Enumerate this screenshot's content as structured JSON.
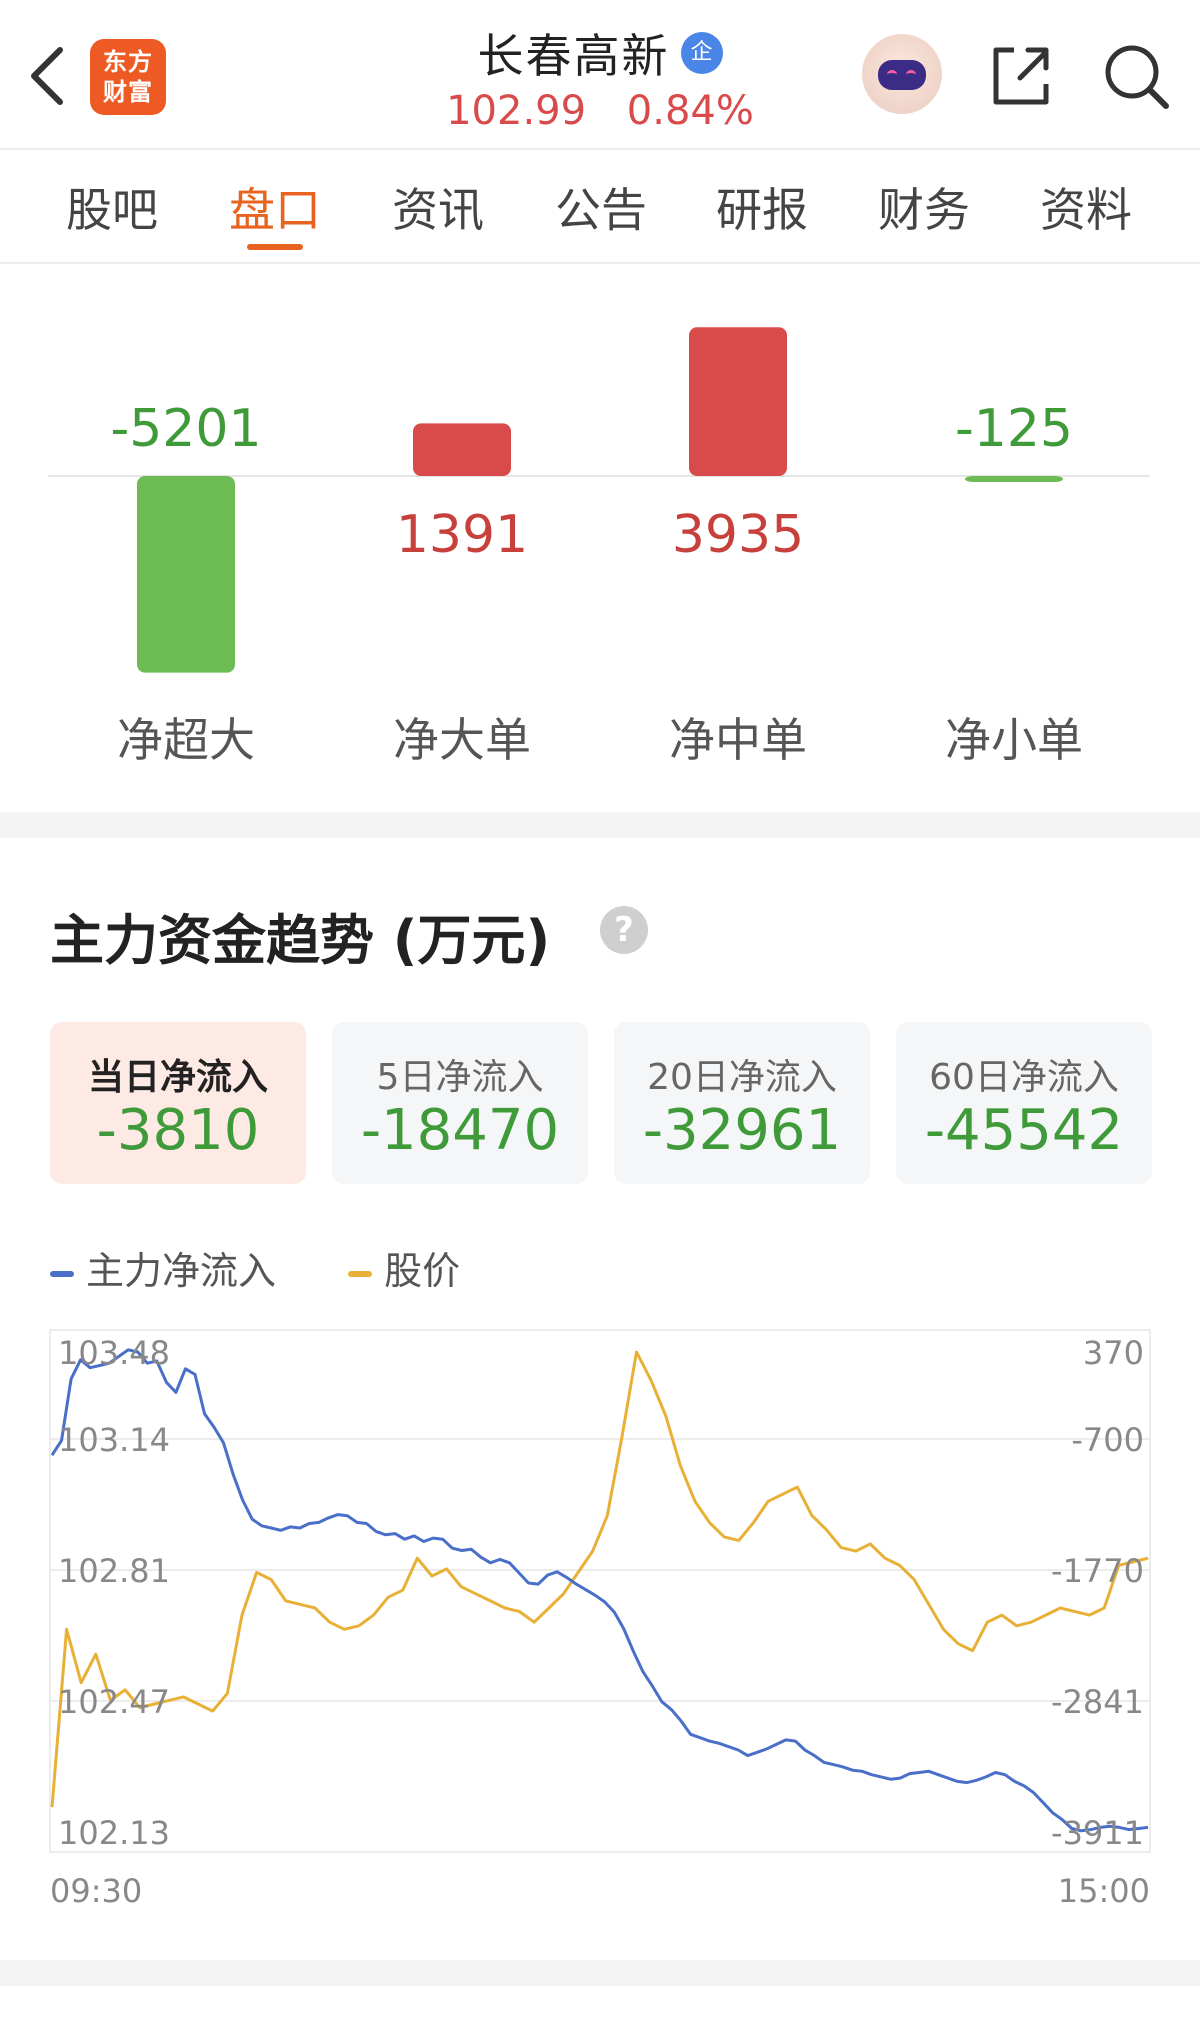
{
  "header": {
    "logo_line1": "东方",
    "logo_line2": "财富",
    "stock_name": "长春高新",
    "badge": "企",
    "price": "102.99",
    "change_pct": "0.84%"
  },
  "tabs": [
    {
      "label": "股吧"
    },
    {
      "label": "盘口",
      "active": true
    },
    {
      "label": "资讯"
    },
    {
      "label": "公告"
    },
    {
      "label": "研报"
    },
    {
      "label": "财务"
    },
    {
      "label": "资料"
    }
  ],
  "flow": {
    "items": [
      {
        "label": "净超大",
        "value": -5201
      },
      {
        "label": "净大单",
        "value": 1391
      },
      {
        "label": "净中单",
        "value": 3935
      },
      {
        "label": "净小单",
        "value": -125
      }
    ],
    "colors": {
      "positive": "#d94b4b",
      "negative": "#6dbb53",
      "positive_text": "#c8403c",
      "negative_text": "#3f9a3a"
    }
  },
  "trend": {
    "title": "主力资金趋势 (万元)",
    "help": "?",
    "periods": [
      {
        "label": "当日净流入",
        "value": "-3810",
        "active": true
      },
      {
        "label": "5日净流入",
        "value": "-18470"
      },
      {
        "label": "20日净流入",
        "value": "-32961"
      },
      {
        "label": "60日净流入",
        "value": "-45542"
      }
    ]
  },
  "chart_data": {
    "type": "line",
    "x_start_label": "09:30",
    "x_end_label": "15:00",
    "left_axis": {
      "ticks": [
        "103.48",
        "103.14",
        "102.81",
        "102.47",
        "102.13"
      ],
      "ylim": [
        102.13,
        103.48
      ]
    },
    "right_axis": {
      "ticks": [
        "370",
        "-700",
        "-1770",
        "-2841",
        "-3911"
      ],
      "ylim": [
        -3911,
        370
      ]
    },
    "grid": true,
    "legend_position": "top-left",
    "series": [
      {
        "name": "主力净流入",
        "color": "#4a6fc9",
        "axis": "right",
        "values": [
          -550,
          -420,
          130,
          300,
          230,
          250,
          270,
          330,
          390,
          370,
          270,
          290,
          100,
          10,
          220,
          170,
          -180,
          -300,
          -440,
          -720,
          -950,
          -1120,
          -1180,
          -1200,
          -1220,
          -1190,
          -1200,
          -1160,
          -1150,
          -1110,
          -1080,
          -1090,
          -1150,
          -1160,
          -1230,
          -1260,
          -1250,
          -1300,
          -1270,
          -1320,
          -1290,
          -1300,
          -1380,
          -1400,
          -1390,
          -1460,
          -1510,
          -1480,
          -1510,
          -1600,
          -1690,
          -1700,
          -1620,
          -1590,
          -1640,
          -1700,
          -1750,
          -1800,
          -1860,
          -1950,
          -2100,
          -2300,
          -2480,
          -2610,
          -2750,
          -2820,
          -2920,
          -3040,
          -3070,
          -3100,
          -3120,
          -3150,
          -3180,
          -3230,
          -3200,
          -3170,
          -3130,
          -3090,
          -3100,
          -3180,
          -3230,
          -3290,
          -3310,
          -3330,
          -3360,
          -3370,
          -3400,
          -3420,
          -3440,
          -3430,
          -3390,
          -3380,
          -3370,
          -3400,
          -3430,
          -3460,
          -3470,
          -3450,
          -3420,
          -3380,
          -3400,
          -3460,
          -3500,
          -3560,
          -3650,
          -3740,
          -3800,
          -3880,
          -3900,
          -3890,
          -3870,
          -3860,
          -3870,
          -3890,
          -3880,
          -3870
        ]
      },
      {
        "name": "股价",
        "color": "#e8b036",
        "axis": "left",
        "values": [
          102.2,
          102.7,
          102.55,
          102.63,
          102.5,
          102.53,
          102.48,
          102.49,
          102.5,
          102.51,
          102.49,
          102.47,
          102.52,
          102.74,
          102.86,
          102.84,
          102.78,
          102.77,
          102.76,
          102.72,
          102.7,
          102.71,
          102.74,
          102.79,
          102.81,
          102.9,
          102.85,
          102.87,
          102.82,
          102.8,
          102.78,
          102.76,
          102.75,
          102.72,
          102.76,
          102.8,
          102.86,
          102.92,
          103.02,
          103.24,
          103.48,
          103.4,
          103.3,
          103.16,
          103.06,
          103.0,
          102.96,
          102.95,
          103.0,
          103.06,
          103.08,
          103.1,
          103.02,
          102.98,
          102.93,
          102.92,
          102.94,
          102.9,
          102.88,
          102.84,
          102.77,
          102.7,
          102.66,
          102.64,
          102.72,
          102.74,
          102.71,
          102.72,
          102.74,
          102.76,
          102.75,
          102.74,
          102.76,
          102.88,
          102.89,
          102.9
        ]
      }
    ]
  }
}
